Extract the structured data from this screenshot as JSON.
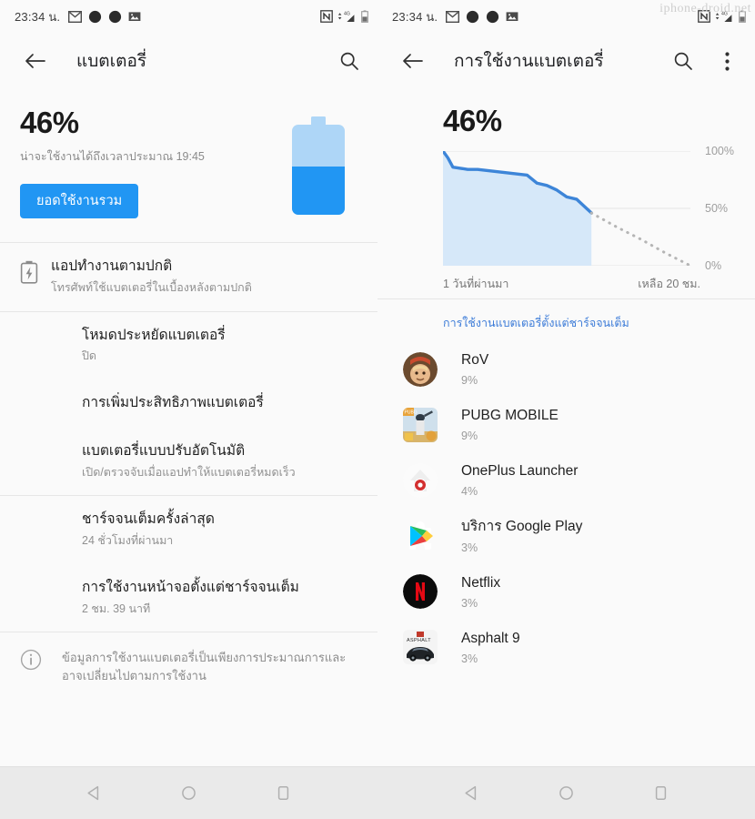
{
  "status_bar": {
    "time": "23:34 น.",
    "left_icons": [
      "gmail-icon",
      "dot-icon",
      "dot-icon",
      "photo-icon"
    ],
    "right_icons": [
      "nfc-icon",
      "signal-4g-icon",
      "battery-icon"
    ]
  },
  "watermark": "iphone-droid.net",
  "left_screen": {
    "app_bar": {
      "title": "แบตเตอรี่",
      "back_icon": "back-arrow-icon",
      "search_icon": "search-icon"
    },
    "summary": {
      "percent": "46%",
      "estimate": "น่าจะใช้งานได้ถึงเวลาประมาณ 19:45",
      "button_label": "ยอดใช้งานรวม",
      "battery_fill_percent": 46
    },
    "rows": [
      {
        "icon": "battery-bolt-icon",
        "title": "แอปทำงานตามปกติ",
        "subtitle": "โทรศัพท์ใช้แบตเตอรี่ในเบื้องหลังตามปกติ",
        "has_icon": true
      },
      {
        "title": "โหมดประหยัดแบตเตอรี่",
        "subtitle": "ปิด",
        "has_icon": false
      },
      {
        "title": "การเพิ่มประสิทธิภาพแบตเตอรี่",
        "subtitle": "",
        "has_icon": false
      },
      {
        "title": "แบตเตอรี่แบบปรับอัตโนมัติ",
        "subtitle": "เปิด/ตรวจจับเมื่อแอปทำให้แบตเตอรี่หมดเร็ว",
        "has_icon": false
      },
      {
        "title": "ชาร์จจนเต็มครั้งล่าสุด",
        "subtitle": "24 ชั่วโมงที่ผ่านมา",
        "has_icon": false
      },
      {
        "title": "การใช้งานหน้าจอตั้งแต่ชาร์จจนเต็ม",
        "subtitle": "2 ชม. 39 นาที",
        "has_icon": false
      }
    ],
    "footnote": {
      "icon": "info-icon",
      "text": "ข้อมูลการใช้งานแบตเตอรี่เป็นเพียงการประมาณการและอาจเปลี่ยนไปตามการใช้งาน"
    }
  },
  "right_screen": {
    "app_bar": {
      "title": "การใช้งานแบตเตอรี่",
      "back_icon": "back-arrow-icon",
      "search_icon": "search-icon",
      "overflow_icon": "more-vertical-icon"
    },
    "percent": "46%",
    "section_header": "การใช้งานแบตเตอรี่ตั้งแต่ชาร์จจนเต็ม",
    "apps": [
      {
        "name": "RoV",
        "percent": "9%",
        "icon": "rov-icon",
        "shape": "circle"
      },
      {
        "name": "PUBG MOBILE",
        "percent": "9%",
        "icon": "pubg-icon",
        "shape": "square"
      },
      {
        "name": "OnePlus Launcher",
        "percent": "4%",
        "icon": "oneplus-launcher-icon",
        "shape": "circle"
      },
      {
        "name": "บริการ Google Play",
        "percent": "3%",
        "icon": "google-play-services-icon",
        "shape": "square"
      },
      {
        "name": "Netflix",
        "percent": "3%",
        "icon": "netflix-icon",
        "shape": "circle"
      },
      {
        "name": "Asphalt 9",
        "percent": "3%",
        "icon": "asphalt9-icon",
        "shape": "square"
      }
    ]
  },
  "chart_data": {
    "type": "area",
    "title": "46%",
    "xlabel": "",
    "ylabel": "",
    "ylim": [
      0,
      100
    ],
    "ytick_labels": [
      "100%",
      "50%",
      "0%"
    ],
    "ytick_values": [
      100,
      50,
      0
    ],
    "x_axis_labels": {
      "start": "1 วันที่ผ่านมา",
      "end": "เหลือ 20 ชม."
    },
    "grid": true,
    "legend_position": "none",
    "series": [
      {
        "name": "battery-history",
        "style": "solid",
        "color": "#3d85d8",
        "fill_color": "#d6e8f9",
        "x": [
          0,
          2,
          4,
          7,
          10,
          14,
          18,
          22,
          26,
          30,
          34,
          38,
          42,
          46,
          50,
          54,
          58,
          60
        ],
        "values": [
          100,
          94,
          86,
          85,
          84,
          84,
          83,
          82,
          81,
          80,
          79,
          72,
          70,
          66,
          60,
          58,
          50,
          46
        ]
      },
      {
        "name": "battery-projection",
        "style": "dotted",
        "color": "#b5b5b5",
        "x": [
          60,
          70,
          80,
          90,
          100
        ],
        "values": [
          46,
          34,
          23,
          11,
          0
        ]
      }
    ]
  },
  "nav_bar": {
    "buttons": [
      "back-triangle-icon",
      "home-circle-icon",
      "recents-square-icon"
    ]
  }
}
